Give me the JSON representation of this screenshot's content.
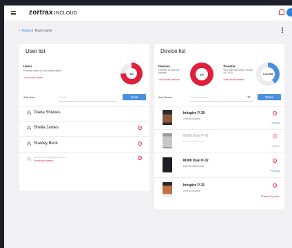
{
  "header": {
    "logo": "zortrax",
    "logo_sub": "INCLOUD"
  },
  "breadcrumb": {
    "parent": "Teams",
    "separator": " | ",
    "current": "Team name"
  },
  "user_list": {
    "title": "User list",
    "users_label": "Users",
    "users_desc": "Possible users in your subscription",
    "add_more_link": "+Add more Users",
    "donut_value": "3/4",
    "add_user_label": "Add User",
    "email_placeholder": "E-mail",
    "invite_label": "Invite",
    "users": [
      {
        "name": "Diana Shieves"
      },
      {
        "name": "Sheila James"
      },
      {
        "name": "Stanley Beck"
      }
    ],
    "pending": {
      "email": "jhonsson.hurray@gmail.com",
      "status": "Pending invitation"
    }
  },
  "device_list": {
    "title": "Device list",
    "devices_label": "Devices",
    "devices_desc": "Number of your 3D printers",
    "add_more_link": "+Add more devices",
    "donut_value": "4/4",
    "transfer_label": "Transfer",
    "transfer_desc": "Your plan will renew on Apr 19, 2020",
    "transfer_link": "+Add more transfer",
    "transfer_value": "0.1/4 GB",
    "add_device_label": "Add Device",
    "device_placeholder": "Choose device",
    "share_label": "Share",
    "devices": [
      {
        "name": "Inkspire P-39",
        "sub": "Zortrax Inkspire",
        "status": "Ready",
        "status_color": "#4a90e2",
        "thumb": "#8a5a3a",
        "dim": false
      },
      {
        "name": "M300 Dual P-43",
        "sub": "Zortrax M300 Dual",
        "status": "Offline",
        "status_color": "#aaaaaa",
        "thumb": "#b0b0b0",
        "dim": true
      },
      {
        "name": "M300 Dual P-32",
        "sub": "Zortrax M300 Dual",
        "status": "Printing",
        "status_color": "#4a90e2",
        "thumb": "#2a2a30",
        "dim": false
      },
      {
        "name": "Inkspire P-31",
        "sub": "Zortrax Inkspire",
        "status": "Shared by user",
        "status_color": "#e0203a",
        "thumb": "#c27040",
        "dim": false
      }
    ]
  },
  "colors": {
    "accent": "#4a90e2",
    "danger": "#e0203a"
  },
  "icons": {
    "menu": "hamburger-icon",
    "notification": "bell-icon",
    "user": "user-icon",
    "remove": "remove-circle-icon"
  }
}
